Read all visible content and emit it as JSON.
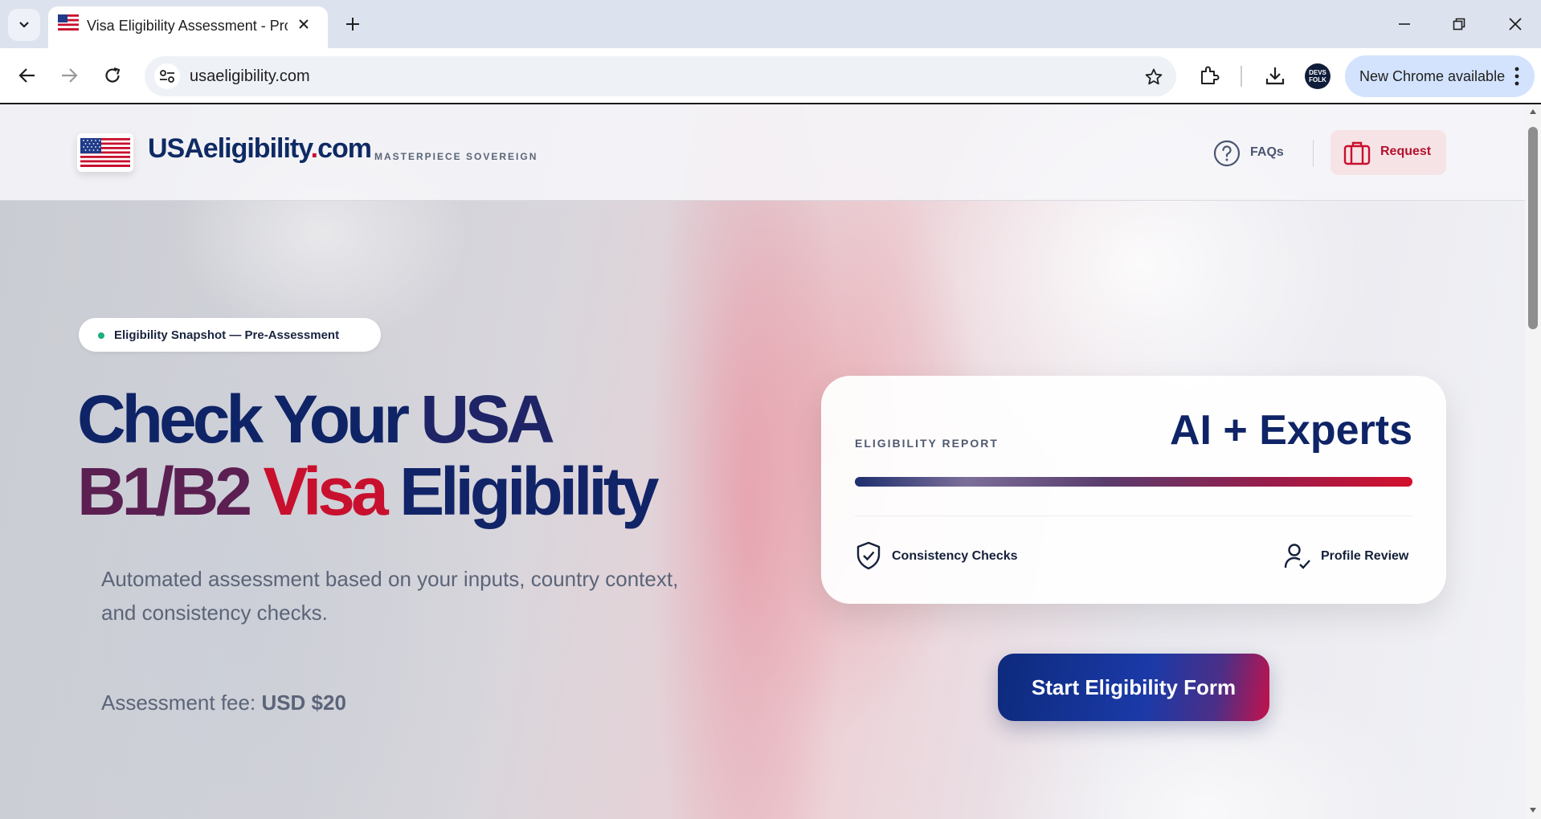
{
  "browser": {
    "tab": {
      "title": "Visa Eligibility Assessment - Pro",
      "favicon": "us-flag-icon"
    },
    "url": "usaeligibility.com",
    "profile_avatar_text": "DEVS FOLK",
    "update_pill": "New Chrome available",
    "icons": [
      "tab-search-icon",
      "close-icon",
      "plus-icon",
      "minimize-icon",
      "restore-icon",
      "window-close-icon",
      "back-icon",
      "forward-icon",
      "reload-icon",
      "site-info-icon",
      "star-icon",
      "extensions-icon",
      "download-icon",
      "more-vert-icon"
    ]
  },
  "site": {
    "brand": {
      "name": "USAeligibility",
      "dot": ".",
      "tld": "com",
      "tagline": "MASTERPIECE SOVEREIGN"
    },
    "nav": {
      "faq": "FAQs",
      "request": "Request"
    },
    "hero": {
      "badge": "Eligibility Snapshot — Pre-Assessment",
      "headline_line1": [
        "Check Your",
        "USA"
      ],
      "headline_line2": [
        "B1/B2",
        "Visa",
        "Eligibility"
      ],
      "subtext": "Automated assessment based on your inputs, country context, and consistency checks.",
      "fee_label": "Assessment fee:",
      "fee_amount": "USD $20"
    },
    "report_card": {
      "label": "ELIGIBILITY REPORT",
      "headline": "AI + Experts",
      "checks": [
        "Consistency Checks",
        "Profile Review"
      ]
    },
    "cta": "Start Eligibility Form"
  },
  "colors": {
    "navy": "#0f2466",
    "red": "#c8102e",
    "plum": "#5b1f52",
    "accent_green": "#19b07a"
  }
}
